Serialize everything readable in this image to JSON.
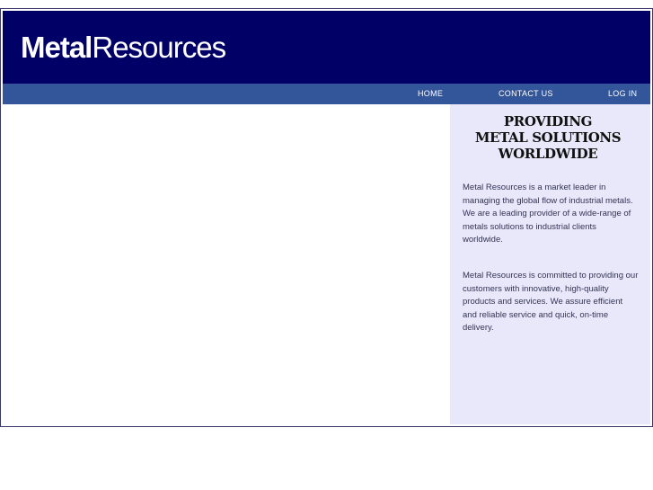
{
  "logo": {
    "bold_part": "Metal",
    "light_part": "Resources"
  },
  "nav": {
    "home": "HOME",
    "contact": "CONTACT US",
    "login": "LOG IN"
  },
  "sidebar": {
    "tagline": [
      "PROVIDING",
      "METAL SOLUTIONS",
      "WORLDWIDE"
    ],
    "paragraph1": "Metal Resources is a market leader in managing the global flow of industrial metals. We are a leading provider of a wide-range of metals solutions to industrial clients worldwide.",
    "paragraph2": "Metal Resources is committed to providing our customers with innovative, high-quality products and services. We assure efficient and reliable service and quick, on-time delivery."
  },
  "colors": {
    "header_bg": "#000066",
    "navbar_bg": "#335599",
    "sidebar_bg": "#e8e8fa"
  }
}
